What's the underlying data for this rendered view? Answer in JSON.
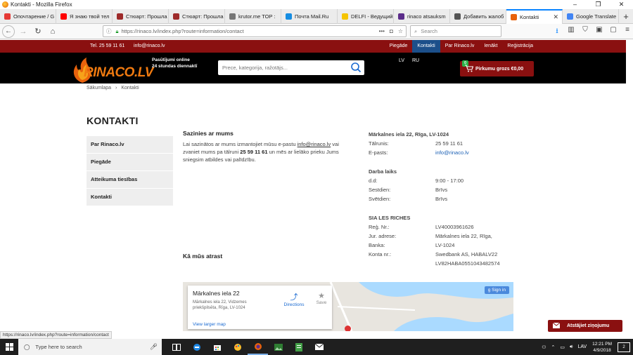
{
  "window": {
    "title": "Kontakti - Mozilla Firefox",
    "minimize": "–",
    "maximize": "❐",
    "close": "✕"
  },
  "tabs": [
    {
      "label": "Опочтарение / G",
      "color": "#e53935"
    },
    {
      "label": "Я знаю твой тел",
      "color": "#ff0000"
    },
    {
      "label": "Стюарт: Прошла",
      "color": "#9e2b2b"
    },
    {
      "label": "Стюарт: Прошла",
      "color": "#9e2b2b"
    },
    {
      "label": "krutor.me TOP :",
      "color": "#777777"
    },
    {
      "label": "Почта Mail.Ru",
      "color": "#168de2"
    },
    {
      "label": "DELFI - Ведущий",
      "color": "#f5c400"
    },
    {
      "label": "rinaco atsauksm",
      "color": "#5b2c8a"
    },
    {
      "label": "Добавить жалоб",
      "color": "#555555"
    },
    {
      "label": "Kontakti",
      "color": "#e8620c",
      "active": true
    },
    {
      "label": "Google Translate",
      "color": "#4285f4"
    }
  ],
  "nav": {
    "url": "https://rinaco.lv/index.php?route=information/contact",
    "search_placeholder": "Search",
    "dots": "•••"
  },
  "site": {
    "phone": "Tel. 25 59 11 61",
    "email": "info@rinaco.lv",
    "menu": [
      {
        "label": "Piegāde",
        "active": false
      },
      {
        "label": "Kontakti",
        "active": true
      },
      {
        "label": "Par Rinaco.lv",
        "active": false
      },
      {
        "label": "Ienākt",
        "active": false
      },
      {
        "label": "Reģistrācija",
        "active": false
      }
    ],
    "logo_text": "RINACO.LV",
    "slogan_1": "Pasūtījumi online",
    "slogan_2": "24 stundas diennaktī",
    "search_placeholder": "Prece, kategorija, ražotājs...",
    "lang_lv": "LV",
    "lang_ru": "RU",
    "cart_count": "0",
    "cart_label": "Pirkumu grozs €0,00"
  },
  "breadcrumb": {
    "home": "Sākumlapa",
    "sep": "›",
    "current": "Kontakti"
  },
  "page_title": "KONTAKTI",
  "sidebar": [
    "Par Rinaco.lv",
    "Piegāde",
    "Atteikuma tiesības",
    "Kontakti"
  ],
  "contact": {
    "heading": "Sazinies ar mums",
    "text_1": "Lai sazinātos ar mums izmantojiet mūsu e-pastu ",
    "email": "info@rinaco.lv",
    "text_2": " vai zvaniet mums pa tālruni ",
    "phone": "25 59 11 61",
    "text_3": " un mēs ar lielāko prieku Jums sniegsim atbildes vai palīdzību."
  },
  "info": {
    "address_heading": "Mārkalnes iela 22, Rīga, LV-1024",
    "phone_label": "Tālrunis:",
    "phone": "25 59 11 61",
    "email_label": "E-pasts:",
    "email": "info@rinaco.lv",
    "hours_heading": "Darba laiks",
    "hours": [
      {
        "day": "d.d:",
        "value": "9:00 - 17:00"
      },
      {
        "day": "Sestdien:",
        "value": "Brīvs"
      },
      {
        "day": "Svētdien:",
        "value": "Brīvs"
      }
    ],
    "company_heading": "SIA LES RICHES",
    "reg_label": "Reģ. Nr.:",
    "reg": "LV40003961626",
    "jur_label": "Jur. adrese:",
    "jur_1": "Mārkalnes iela 22, Rīga,",
    "jur_2": "LV-1024",
    "bank_label": "Banka:",
    "bank": "Swedbank AS, HABALV22",
    "konta_label": "Konta nr.:",
    "konta": "LV82HABA0551043482574"
  },
  "find_heading": "Kā mūs atrast",
  "map": {
    "title": "Mārkalnes iela 22",
    "address": "Mārkalnes iela 22, Vidzemes priekšpilsēta, Rīga, LV-1024",
    "directions": "Directions",
    "save": "Save",
    "larger": "View larger map",
    "signin": "Sign in"
  },
  "report_label": "Atstājiet ziņojumu",
  "status_url": "https://rinaco.lv/index.php?route=information/contact",
  "taskbar": {
    "search_placeholder": "Type here to search",
    "lang": "LAV",
    "time": "12:21 PM",
    "date": "4/9/2018",
    "notif": "2"
  }
}
